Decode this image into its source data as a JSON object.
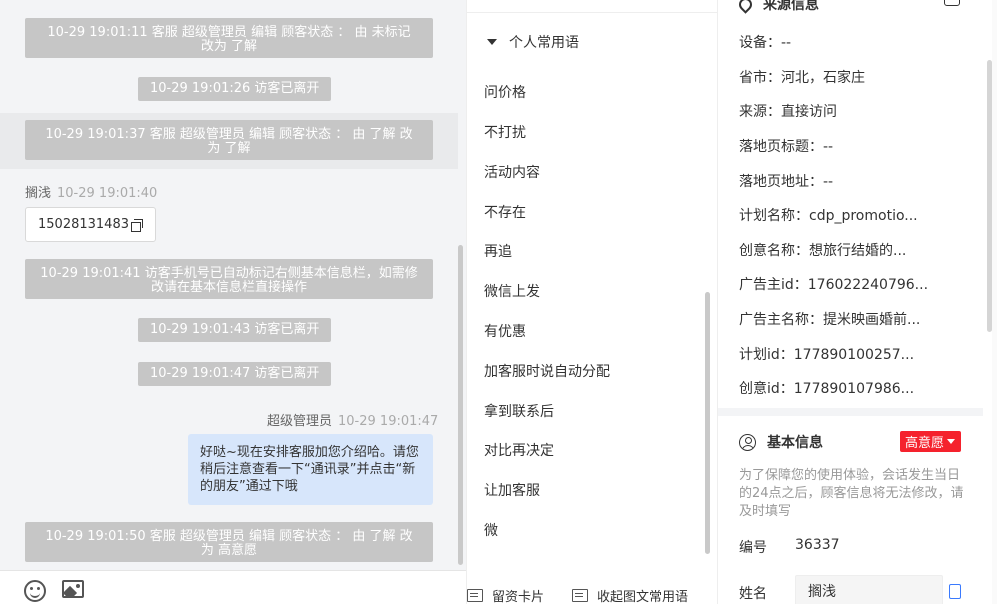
{
  "chat": {
    "sys_msgs": [
      "10-29 19:01:11 客服 超级管理员 编辑 顾客状态 ： 由 未标记 改为 了解",
      "10-29 19:01:26 访客已离开",
      "10-29 19:01:37 客服 超级管理员 编辑 顾客状态 ： 由 了解 改为 了解",
      "10-29 19:01:41 访客手机号已自动标记右侧基本信息栏，如需修改请在基本信息栏直接操作",
      "10-29 19:01:43 访客已离开",
      "10-29 19:01:47 访客已离开",
      "10-29 19:01:50 客服 超级管理员 编辑 顾客状态 ： 由 了解 改为 高意愿"
    ],
    "visitor_name": "搁浅",
    "visitor_time": "10-29 19:01:40",
    "visitor_phone": "15028131483",
    "agent_name": "超级管理员",
    "agent_time": "10-29 19:01:47",
    "agent_message": "好哒~现在安排客服加您介绍哈。请您稍后注意查看一下“通讯录”并点击“新的朋友”通过下哦"
  },
  "phrases": {
    "group_title": "个人常用语",
    "items": [
      "问价格",
      "不打扰",
      "活动内容",
      "不存在",
      "再追",
      "微信上发",
      "有优惠",
      "加客服时说自动分配",
      "拿到联系后",
      "对比再决定",
      "让加客服",
      "微"
    ],
    "footer_card": "留资卡片",
    "footer_collapse": "收起图文常用语"
  },
  "source": {
    "title": "来源信息",
    "rows": [
      "设备：--",
      "省市：河北，石家庄",
      "来源：直接访问",
      "落地页标题：--",
      "落地页地址：--",
      "计划名称：cdp_promotio...",
      "创意名称：想旅行结婚的...",
      "广告主id：176022240796...",
      "广告主名称：提米映画婚前...",
      "计划id：177890100257...",
      "创意id：177890107986..."
    ]
  },
  "basic": {
    "title": "基本信息",
    "badge": "高意愿",
    "notice": "为了保障您的使用体验，会话发生当日的24点之后，顾客信息将无法修改，请及时填写",
    "id_label": "编号",
    "id_value": "36337",
    "name_label": "姓名",
    "name_value": "搁浅"
  },
  "colors": {
    "badge": "#f5222d",
    "bubble": "#d7e6fb",
    "system": "#c6c6c6"
  }
}
